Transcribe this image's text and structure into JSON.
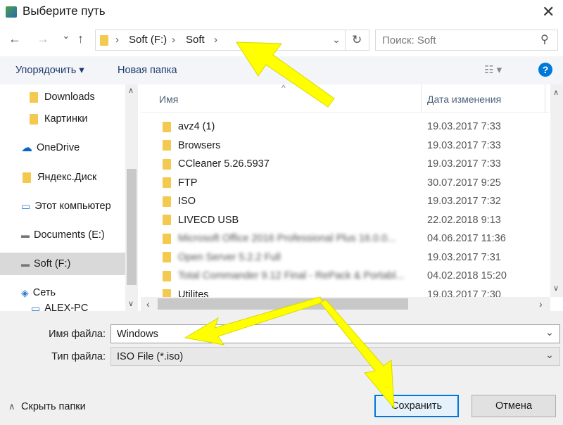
{
  "window": {
    "title": "Выберите путь",
    "close": "✕"
  },
  "nav": {
    "back": "←",
    "forward": "→",
    "recent": "⌄",
    "up": "↑",
    "breadcrumb": [
      "Soft (F:)",
      "Soft"
    ],
    "search_placeholder": "Поиск: Soft"
  },
  "toolbar": {
    "organize": "Упорядочить ▾",
    "new_folder": "Новая папка"
  },
  "sidebar": {
    "items": [
      {
        "label": "Downloads",
        "icon": "folder-icon"
      },
      {
        "label": "Картинки",
        "icon": "folder-icon"
      },
      {
        "label": "OneDrive",
        "icon": "cloud-icon"
      },
      {
        "label": "Яндекс.Диск",
        "icon": "folder-icon"
      },
      {
        "label": "Этот компьютер",
        "icon": "computer-icon"
      },
      {
        "label": "Documents (E:)",
        "icon": "drive-icon"
      },
      {
        "label": "Soft (F:)",
        "icon": "drive-icon",
        "selected": true
      },
      {
        "label": "Сеть",
        "icon": "network-icon"
      },
      {
        "label": "ALEX-PC",
        "icon": "computer-icon"
      }
    ]
  },
  "files": {
    "columns": [
      "Имя",
      "Дата изменения"
    ],
    "rows": [
      {
        "name": "avz4 (1)",
        "date": "19.03.2017 7:33"
      },
      {
        "name": "Browsers",
        "date": "19.03.2017 7:33"
      },
      {
        "name": "CCleaner 5.26.5937",
        "date": "19.03.2017 7:33"
      },
      {
        "name": "FTP",
        "date": "30.07.2017 9:25"
      },
      {
        "name": "ISO",
        "date": "19.03.2017 7:32"
      },
      {
        "name": "LIVECD USB",
        "date": "22.02.2018 9:13"
      },
      {
        "name": "Microsoft Office 2016 Professional Plus 16.0.0...",
        "date": "04.06.2017 11:36",
        "blurred": true
      },
      {
        "name": "Open Server 5.2.2 Full",
        "date": "19.03.2017 7:31",
        "blurred": true
      },
      {
        "name": "Total Commander 9.12 Final - RePack & Portabl...",
        "date": "04.02.2018 15:20",
        "blurred": true
      },
      {
        "name": "Utilites",
        "date": "19.03.2017 7:30"
      }
    ]
  },
  "form": {
    "filename_label": "Имя файла:",
    "filename_value": "Windows",
    "filetype_label": "Тип файла:",
    "filetype_value": "ISO File (*.iso)"
  },
  "footer": {
    "hide_folders": "Скрыть папки",
    "save": "Сохранить",
    "cancel": "Отмена"
  },
  "colors": {
    "accent": "#0078d7",
    "arrow": "#ffff00",
    "folder": "#f3c94f"
  }
}
